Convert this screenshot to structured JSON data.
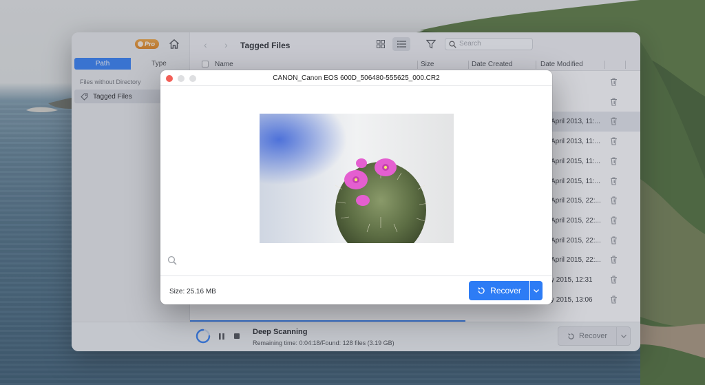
{
  "app": {
    "badge_label": "Pro",
    "sidebar": {
      "tabs": [
        {
          "label": "Path",
          "active": true
        },
        {
          "label": "Type",
          "active": false
        }
      ],
      "section_label": "Files without Directory",
      "items": [
        {
          "label": "Tagged Files",
          "icon": "tag-icon",
          "selected": true
        }
      ]
    },
    "toolbar": {
      "title": "Tagged Files",
      "search_placeholder": "Search"
    },
    "table": {
      "columns": [
        "Name",
        "Size",
        "Date Created",
        "Date Modified"
      ],
      "rows": [
        {
          "date_modified": ""
        },
        {
          "date_modified": ""
        },
        {
          "date_modified": "April 2013, 11:..."
        },
        {
          "date_modified": "April 2013, 11:..."
        },
        {
          "date_modified": "April 2015, 11:..."
        },
        {
          "date_modified": "April 2015, 11:..."
        },
        {
          "date_modified": "April 2015, 22:..."
        },
        {
          "date_modified": "April 2015, 22:..."
        },
        {
          "date_modified": "April 2015, 22:..."
        },
        {
          "date_modified": "April 2015, 22:..."
        },
        {
          "date_modified": "y 2015, 12:31"
        },
        {
          "date_modified": "y 2015, 13:06"
        }
      ]
    },
    "status": {
      "title": "Deep Scanning",
      "subtitle": "Remaining time: 0:04:18/Found: 128 files (3.19 GB)",
      "recover_label": "Recover"
    }
  },
  "dialog": {
    "title": "CANON_Canon EOS 600D_506480-555625_000.CR2",
    "size_label": "Size: 25.16 MB",
    "recover_label": "Recover"
  },
  "colors": {
    "accent": "#2d7cf5",
    "badge": "#e88a1f",
    "close": "#f25f57"
  }
}
